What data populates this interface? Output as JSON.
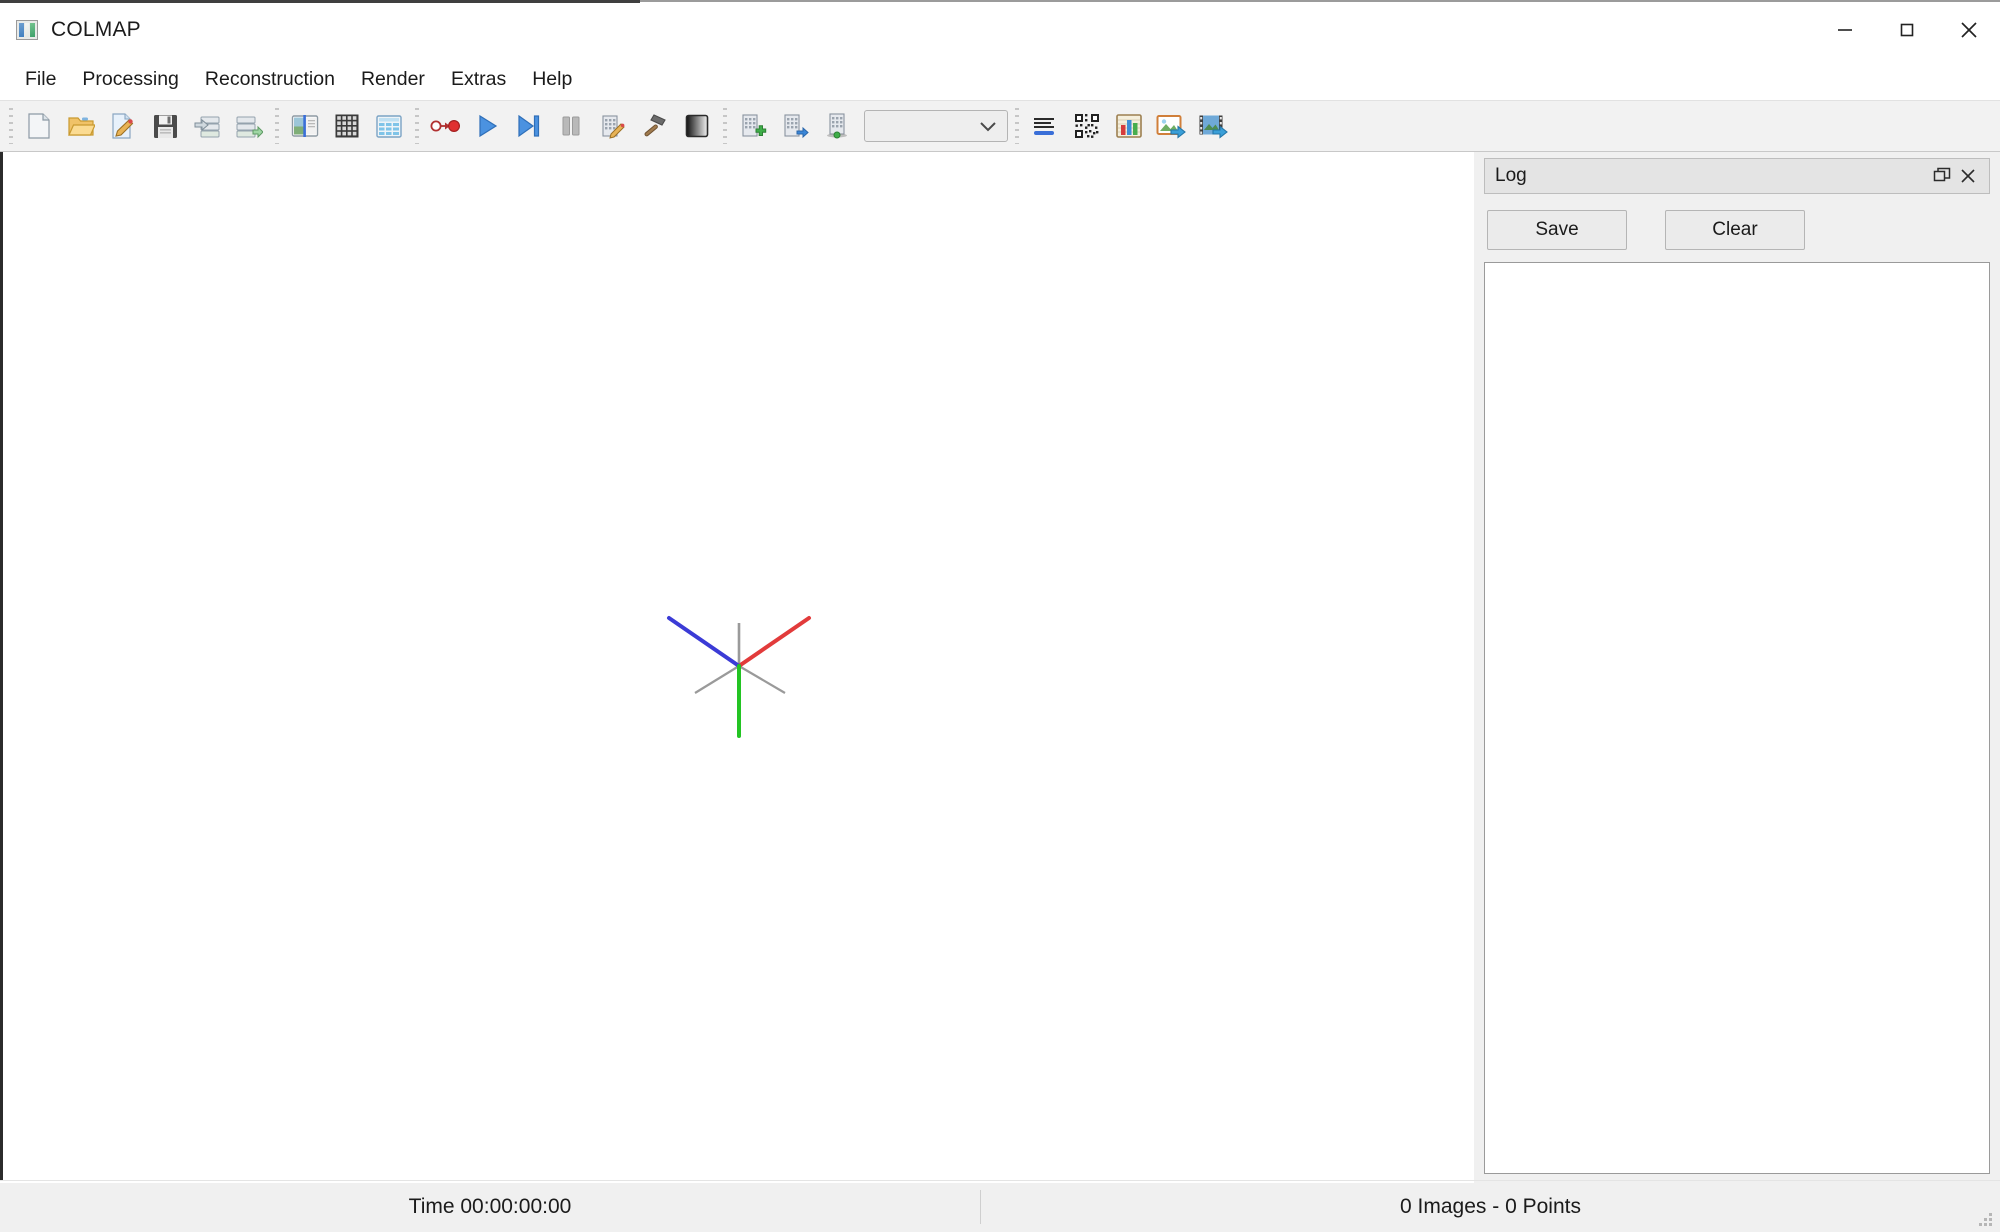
{
  "window": {
    "title": "COLMAP",
    "app_icon": "colmap-app-icon",
    "controls": {
      "minimize": "minimize-icon",
      "maximize": "maximize-icon",
      "close": "close-icon"
    }
  },
  "menubar": {
    "items": [
      {
        "label": "File"
      },
      {
        "label": "Processing"
      },
      {
        "label": "Reconstruction"
      },
      {
        "label": "Render"
      },
      {
        "label": "Extras"
      },
      {
        "label": "Help"
      }
    ]
  },
  "toolbar": {
    "groups": [
      {
        "name": "project-group",
        "buttons": [
          {
            "icon": "new-project-icon",
            "tooltip": "New project"
          },
          {
            "icon": "open-project-icon",
            "tooltip": "Open project"
          },
          {
            "icon": "edit-project-icon",
            "tooltip": "Edit project"
          },
          {
            "icon": "save-project-icon",
            "tooltip": "Save project"
          },
          {
            "icon": "import-model-icon",
            "tooltip": "Import model"
          },
          {
            "icon": "export-model-icon",
            "tooltip": "Export model"
          }
        ]
      },
      {
        "name": "feature-group",
        "buttons": [
          {
            "icon": "feature-extraction-icon",
            "tooltip": "Feature extraction"
          },
          {
            "icon": "feature-matching-grid-icon",
            "tooltip": "Feature matching"
          },
          {
            "icon": "database-management-icon",
            "tooltip": "Database management"
          }
        ]
      },
      {
        "name": "reconstruction-group",
        "buttons": [
          {
            "icon": "automatic-reconstruction-icon",
            "tooltip": "Automatic reconstruction"
          },
          {
            "icon": "start-reconstruction-icon",
            "tooltip": "Start reconstruction"
          },
          {
            "icon": "step-reconstruction-icon",
            "tooltip": "Reconstruct next image"
          },
          {
            "icon": "pause-reconstruction-icon",
            "tooltip": "Pause reconstruction"
          },
          {
            "icon": "reconstruction-options-icon",
            "tooltip": "Reconstruction options"
          },
          {
            "icon": "bundle-adjustment-hammer-icon",
            "tooltip": "Bundle adjustment"
          },
          {
            "icon": "dense-reconstruction-icon",
            "tooltip": "Dense reconstruction"
          }
        ]
      },
      {
        "name": "model-group",
        "buttons": [
          {
            "icon": "add-model-icon",
            "tooltip": "Add model"
          },
          {
            "icon": "next-model-icon",
            "tooltip": "Next model"
          },
          {
            "icon": "anchor-model-icon",
            "tooltip": "Model statistics"
          }
        ],
        "combo": {
          "name": "model-selector",
          "value": "",
          "placeholder": ""
        }
      },
      {
        "name": "view-group",
        "buttons": [
          {
            "icon": "show-log-icon",
            "tooltip": "Show log"
          },
          {
            "icon": "match-matrix-icon",
            "tooltip": "Match matrix"
          },
          {
            "icon": "model-statistics-chart-icon",
            "tooltip": "Model statistics"
          },
          {
            "icon": "grab-image-icon",
            "tooltip": "Grab image"
          },
          {
            "icon": "grab-movie-icon",
            "tooltip": "Grab movie"
          }
        ]
      }
    ]
  },
  "viewport": {
    "name": "3d-model-viewport",
    "background": "#ffffff",
    "gizmo": {
      "name": "coordinate-axes-gizmo",
      "axes": [
        {
          "label": "x",
          "color": "#e23b3b"
        },
        {
          "label": "y",
          "color": "#23c423"
        },
        {
          "label": "z",
          "color": "#3b3bd6"
        }
      ],
      "negative_axis_color": "#8a8a8a"
    }
  },
  "log_panel": {
    "title": "Log",
    "float_icon": "undock-icon",
    "close_icon": "close-icon",
    "buttons": [
      {
        "label": "Save",
        "name": "log-save-button"
      },
      {
        "label": "Clear",
        "name": "log-clear-button"
      }
    ],
    "text_area": {
      "value": "",
      "placeholder": ""
    }
  },
  "statusbar": {
    "time_label": "Time 00:00:00:00",
    "counts_label": "0 Images - 0 Points"
  }
}
